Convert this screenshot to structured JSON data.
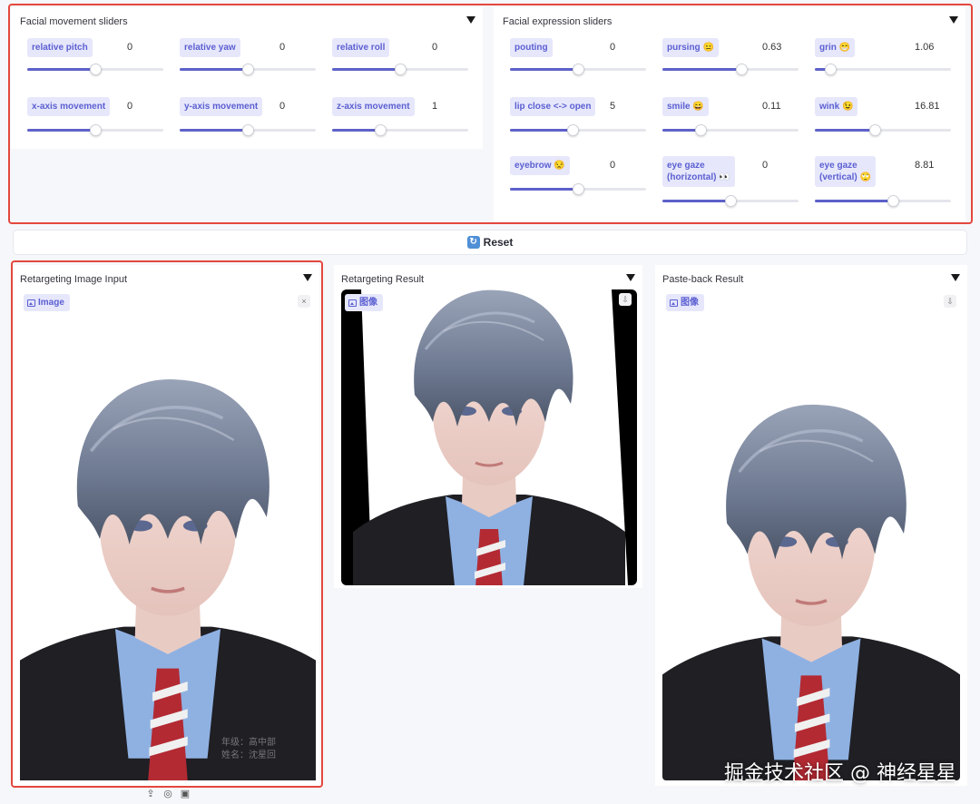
{
  "movement_panel": {
    "title": "Facial movement sliders",
    "sliders": [
      {
        "label": "relative pitch",
        "value": "0",
        "fraction": 0.5
      },
      {
        "label": "relative yaw",
        "value": "0",
        "fraction": 0.5
      },
      {
        "label": "relative roll",
        "value": "0",
        "fraction": 0.5
      },
      {
        "label": "x-axis movement",
        "value": "0",
        "fraction": 0.5
      },
      {
        "label": "y-axis movement",
        "value": "0",
        "fraction": 0.5
      },
      {
        "label": "z-axis movement",
        "value": "1",
        "fraction": 0.35
      }
    ]
  },
  "expression_panel": {
    "title": "Facial expression sliders",
    "sliders": [
      {
        "label": "pouting",
        "value": "0",
        "fraction": 0.5
      },
      {
        "label": "pursing 😐",
        "value": "0.63",
        "fraction": 0.58
      },
      {
        "label": "grin 😁",
        "value": "1.06",
        "fraction": 0.11
      },
      {
        "label": "lip close <-> open",
        "value": "5",
        "fraction": 0.46
      },
      {
        "label": "smile 😄",
        "value": "0.11",
        "fraction": 0.28
      },
      {
        "label": "wink 😉",
        "value": "16.81",
        "fraction": 0.44
      },
      {
        "label": "eyebrow 😒",
        "value": "0",
        "fraction": 0.5
      },
      {
        "label": "eye gaze\n(horizontal) 👀",
        "value": "0",
        "fraction": 0.5
      },
      {
        "label": "eye gaze\n(vertical) 🙄",
        "value": "8.81",
        "fraction": 0.57
      }
    ]
  },
  "reset_button": {
    "label": "Reset",
    "icon": "refresh-icon"
  },
  "input_panel": {
    "title": "Retargeting Image Input",
    "badge": "Image",
    "clear_icon": "×"
  },
  "result_panel": {
    "title": "Retargeting Result",
    "badge": "图像"
  },
  "pasteback_panel": {
    "title": "Paste-back Result",
    "badge": "图像"
  },
  "signature_text": {
    "line1": "年级：高中部",
    "line2": "姓名：沈星回"
  },
  "watermark": "掘金技术社区 @ 神经星星",
  "colors": {
    "accent": "#5e61c9",
    "badge_bg": "#e6e7fb",
    "badge_text": "#5b5fd1",
    "highlight": "#e4473d"
  }
}
